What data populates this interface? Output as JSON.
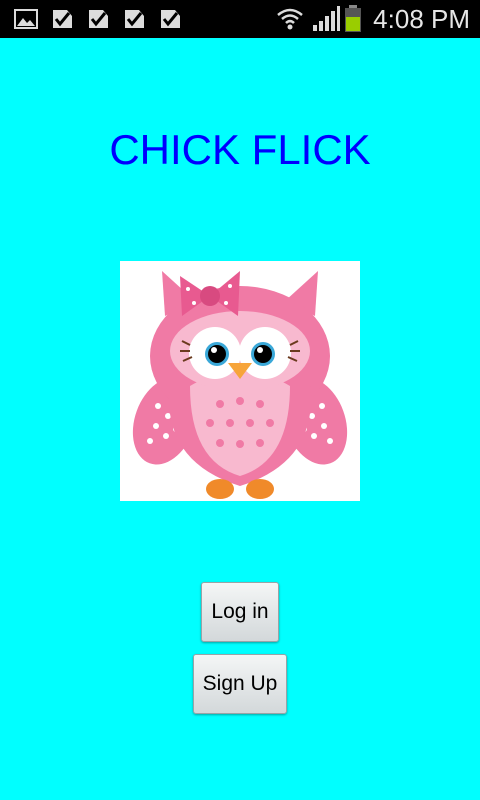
{
  "status_bar": {
    "time": "4:08 PM",
    "notification_icons": [
      "gallery-icon",
      "check-icon",
      "check-icon",
      "check-icon",
      "check-icon"
    ],
    "system_icons": [
      "wifi-icon",
      "signal-icon",
      "battery-icon"
    ]
  },
  "main": {
    "title": "CHICK FLICK",
    "image": "owl-image",
    "login_label": "Log in",
    "signup_label": "Sign Up"
  },
  "colors": {
    "background": "#00ffff",
    "title": "#0000ff",
    "owl_pink": "#f07aa5"
  }
}
